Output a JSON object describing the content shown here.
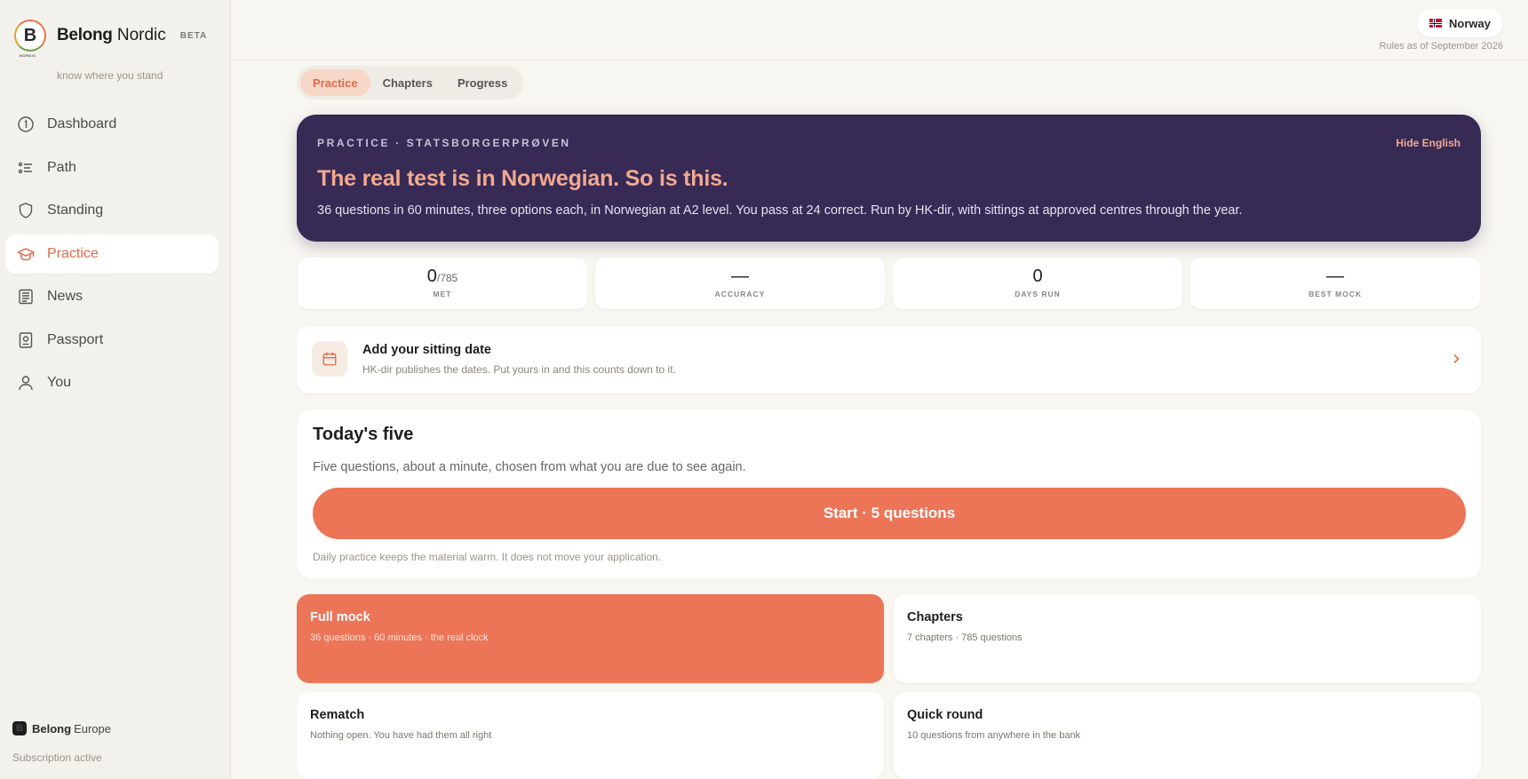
{
  "brand": {
    "logo_letter": "B",
    "logo_sub": "NORDIC",
    "name_bold": "Belong",
    "name_regular": "Nordic",
    "badge": "BETA",
    "tagline": "know where you stand"
  },
  "sidebar": {
    "items": [
      {
        "label": "Dashboard",
        "icon": "dashboard-icon"
      },
      {
        "label": "Path",
        "icon": "path-list-icon"
      },
      {
        "label": "Standing",
        "icon": "shield-icon"
      },
      {
        "label": "Practice",
        "icon": "graduation-cap-icon",
        "active": true
      },
      {
        "label": "News",
        "icon": "newspaper-icon"
      },
      {
        "label": "Passport",
        "icon": "passport-icon"
      },
      {
        "label": "You",
        "icon": "user-icon"
      }
    ],
    "footer_brand_letter": "B",
    "footer_brand_bold": "Belong",
    "footer_brand_regular": "Europe",
    "subscription_status": "Subscription active"
  },
  "header": {
    "country": "Norway",
    "rules_note": "Rules as of September 2026"
  },
  "tabs": [
    {
      "label": "Practice",
      "active": true
    },
    {
      "label": "Chapters"
    },
    {
      "label": "Progress"
    }
  ],
  "hero": {
    "eyebrow": "PRACTICE · STATSBORGERPRØVEN",
    "hide_label": "Hide English",
    "title": "The real test is in Norwegian. So is this.",
    "description": "36 questions in 60 minutes, three options each, in Norwegian at A2 level. You pass at 24 correct. Run by HK-dir, with sittings at approved centres through the year."
  },
  "stats": [
    {
      "value": "0",
      "suffix": "/785",
      "label": "MET"
    },
    {
      "value": "—",
      "suffix": "",
      "label": "ACCURACY"
    },
    {
      "value": "0",
      "suffix": "",
      "label": "DAYS RUN"
    },
    {
      "value": "—",
      "suffix": "",
      "label": "BEST MOCK"
    }
  ],
  "sitting": {
    "title": "Add your sitting date",
    "subtitle": "HK-dir publishes the dates. Put yours in and this counts down to it."
  },
  "todays_five": {
    "title": "Today's five",
    "subtitle": "Five questions, about a minute, chosen from what you are due to see again.",
    "button": "Start · 5 questions",
    "note": "Daily practice keeps the material warm. It does not move your application."
  },
  "modes": [
    {
      "title": "Full mock",
      "subtitle": "36 questions · 60 minutes · the real clock"
    },
    {
      "title": "Chapters",
      "subtitle": "7 chapters · 785 questions"
    },
    {
      "title": "Rematch",
      "subtitle": "Nothing open. You have had them all right"
    },
    {
      "title": "Quick round",
      "subtitle": "10 questions from anywhere in the bank"
    }
  ],
  "colors": {
    "accent": "#ec7558",
    "hero_bg": "#372a55",
    "page_bg": "#f8f6f1"
  }
}
